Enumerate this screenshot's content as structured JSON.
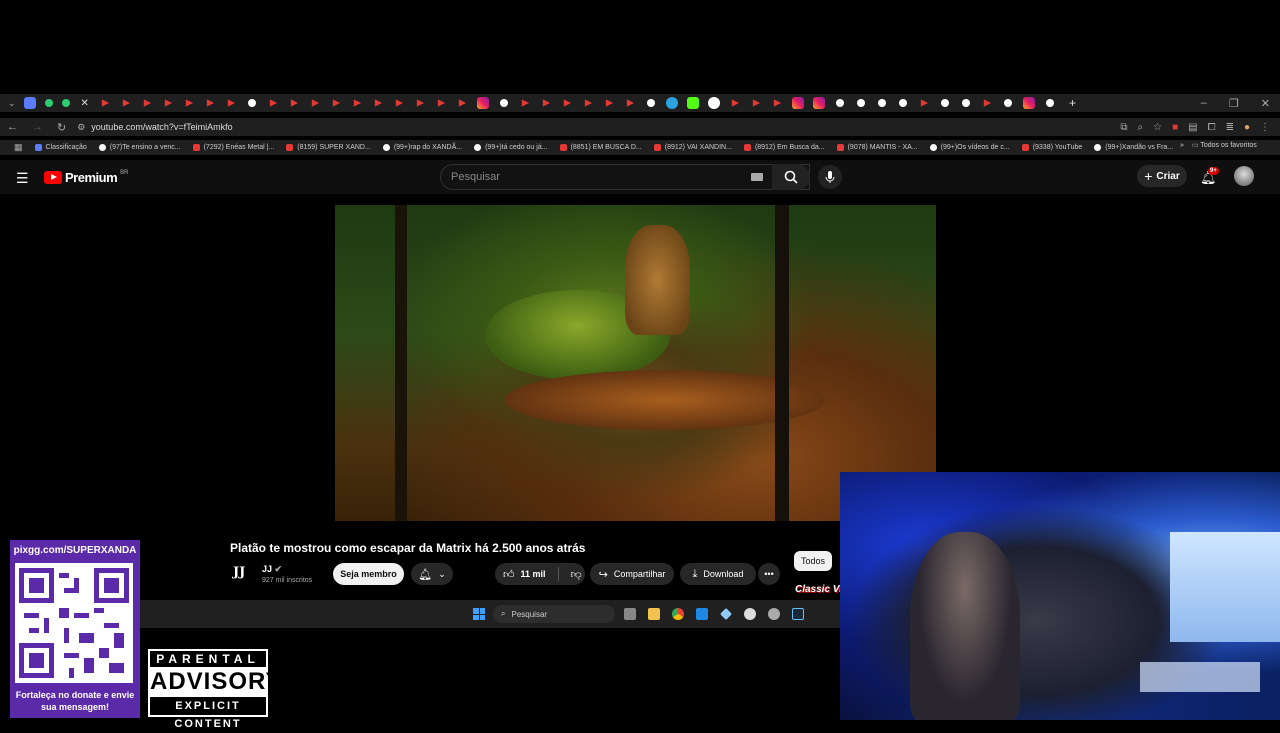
{
  "browser": {
    "url": "youtube.com/watch?v=fTeimiAmkfo",
    "bookmarks": [
      {
        "label": "Classificação",
        "color": "#5b7cff"
      },
      {
        "label": "(97)Te ensino a venc...",
        "color": "#ffffff"
      },
      {
        "label": "(7292) Enéas Metal |...",
        "color": "#e53935"
      },
      {
        "label": "(8159) SUPER XAND...",
        "color": "#e53935"
      },
      {
        "label": "(99+)rap do XANDÃ...",
        "color": "#ffffff"
      },
      {
        "label": "(99+)tá cedo ou já...",
        "color": "#ffffff"
      },
      {
        "label": "(8851) EM BUSCA D...",
        "color": "#e53935"
      },
      {
        "label": "(8912) VAI XANDIN...",
        "color": "#e53935"
      },
      {
        "label": "(8912) Em Busca da...",
        "color": "#e53935"
      },
      {
        "label": "(9078) MANTIS - XA...",
        "color": "#e53935"
      },
      {
        "label": "(99+)Os vídeos de c...",
        "color": "#ffffff"
      },
      {
        "label": "(9338) YouTube",
        "color": "#e53935"
      },
      {
        "label": "(99+)Xandão vs Fra...",
        "color": "#ffffff"
      }
    ],
    "bookmarks_all": "Todos os favoritos"
  },
  "youtube": {
    "logo": "Premium",
    "logo_region": "BR",
    "search_placeholder": "Pesquisar",
    "create_label": "Criar",
    "notif_count": "9+",
    "video_title": "Platão te mostrou como escapar da Matrix há 2.500 anos atrás",
    "channel_logo": "JJ",
    "channel_name": "JJ",
    "subscribers": "927 mil inscritos",
    "member_label": "Seja membro",
    "likes": "11 mil",
    "share_label": "Compartilhar",
    "download_label": "Download",
    "filter_all": "Todos",
    "side_thumb_label": "Classic Vi"
  },
  "taskbar": {
    "search_label": "Pesquisar"
  },
  "overlay": {
    "qr_url": "pixgg.com/SUPERXANDA",
    "qr_message": "Fortaleça no donate e envie sua mensagem!",
    "advisory_top": "PARENTAL",
    "advisory_mid": "ADVISORY",
    "advisory_bot": "EXPLICIT CONTENT"
  },
  "colors": {
    "youtube_red": "#ff0000",
    "qr_panel": "#5b2aa8",
    "chrome_bg": "#1f1f1f"
  }
}
